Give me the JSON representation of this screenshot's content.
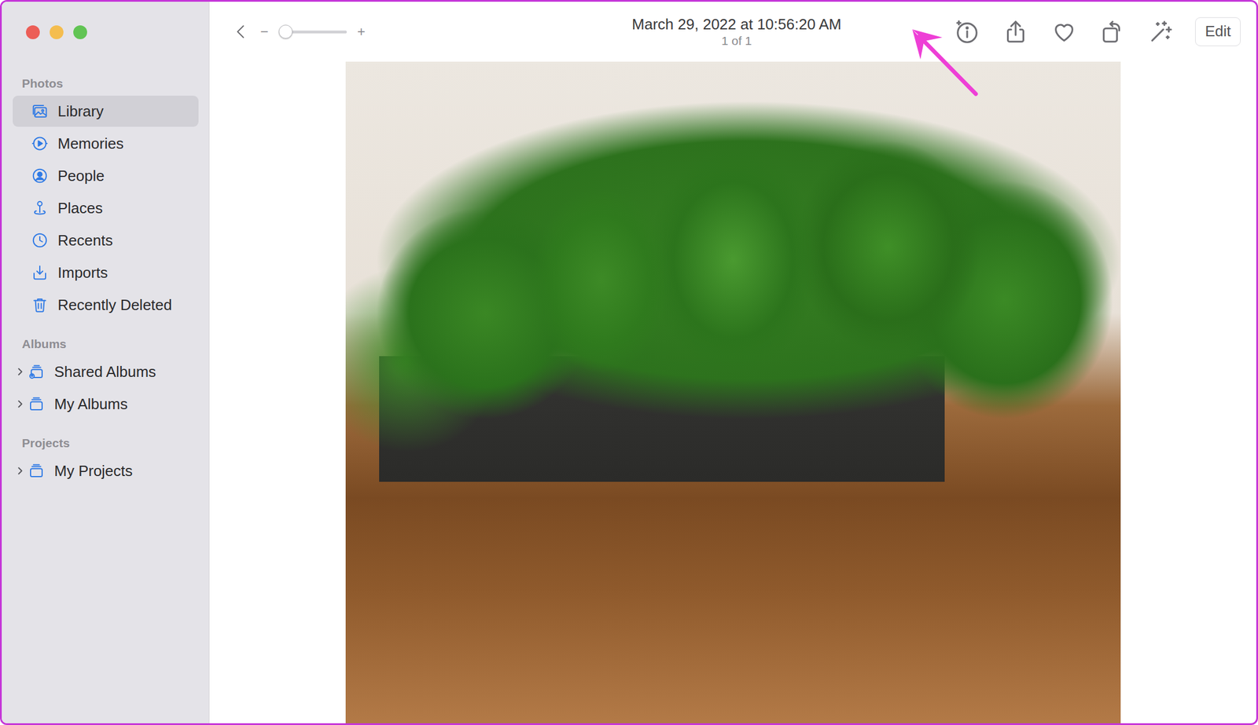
{
  "sidebar": {
    "sections": [
      {
        "title": "Photos",
        "items": [
          {
            "label": "Library",
            "selected": true
          },
          {
            "label": "Memories",
            "selected": false
          },
          {
            "label": "People",
            "selected": false
          },
          {
            "label": "Places",
            "selected": false
          },
          {
            "label": "Recents",
            "selected": false
          },
          {
            "label": "Imports",
            "selected": false
          },
          {
            "label": "Recently Deleted",
            "selected": false
          }
        ]
      },
      {
        "title": "Albums",
        "items": [
          {
            "label": "Shared Albums",
            "selected": false,
            "expanded": false
          },
          {
            "label": "My Albums",
            "selected": false,
            "expanded": false
          }
        ]
      },
      {
        "title": "Projects",
        "items": [
          {
            "label": "My Projects",
            "selected": false,
            "expanded": false
          }
        ]
      }
    ]
  },
  "toolbar": {
    "title": "March 29, 2022 at 10:56:20 AM",
    "subtitle": "1 of 1",
    "zoom": {
      "minus": "−",
      "plus": "+",
      "level": 0.0
    },
    "favorite": false,
    "edit": "Edit"
  }
}
